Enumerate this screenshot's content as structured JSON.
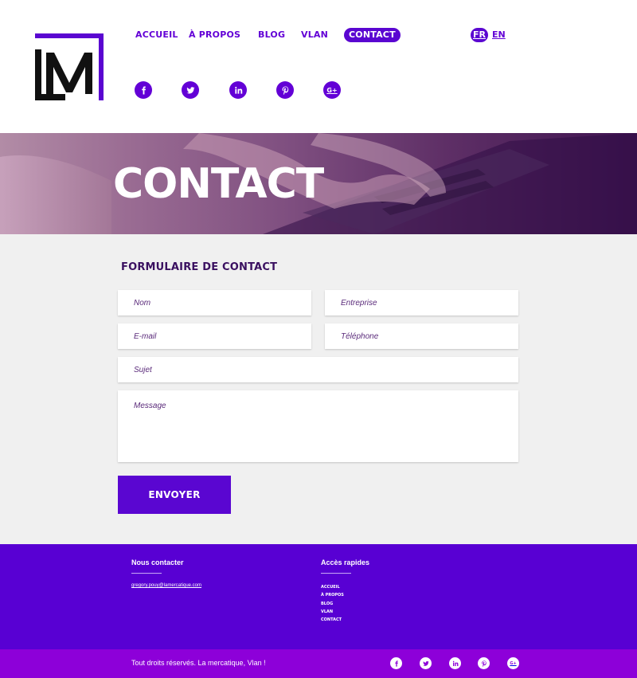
{
  "header": {
    "nav": [
      {
        "label": "ACCUEIL"
      },
      {
        "label": "À PROPOS"
      },
      {
        "label": "BLOG"
      },
      {
        "label": "VLAN"
      },
      {
        "label": "CONTACT",
        "active": true
      }
    ],
    "languages": [
      {
        "label": "FR",
        "active": true
      },
      {
        "label": "EN"
      }
    ],
    "social": [
      "facebook-icon",
      "twitter-icon",
      "linkedin-icon",
      "pinterest-icon",
      "google-plus-icon"
    ],
    "logo_text": "LM"
  },
  "hero": {
    "title": "CONTACT"
  },
  "form": {
    "title": "FORMULAIRE DE CONTACT",
    "fields": {
      "name": {
        "placeholder": "Nom",
        "value": ""
      },
      "company": {
        "placeholder": "Entreprise",
        "value": ""
      },
      "email": {
        "placeholder": "E-mail",
        "value": ""
      },
      "phone": {
        "placeholder": "Téléphone",
        "value": ""
      },
      "subject": {
        "placeholder": "Sujet",
        "value": ""
      },
      "message": {
        "placeholder": "Message",
        "value": ""
      }
    },
    "submit_label": "ENVOYER"
  },
  "footer": {
    "contact_heading": "Nous contacter",
    "email": "gregory.pouy@lamercatique.com",
    "quick_heading": "Accès rapides",
    "quick_links": [
      "ACCUEIL",
      "À PROPOS",
      "BLOG",
      "VLAN",
      "CONTACT"
    ],
    "copyright": "Tout droits réservés. La mercatique, Vlan !"
  },
  "colors": {
    "primary": "#5a06d1",
    "footer": "#5800d3",
    "bottom_bar": "#8d00d9",
    "form_bg": "#f0f0f0"
  }
}
